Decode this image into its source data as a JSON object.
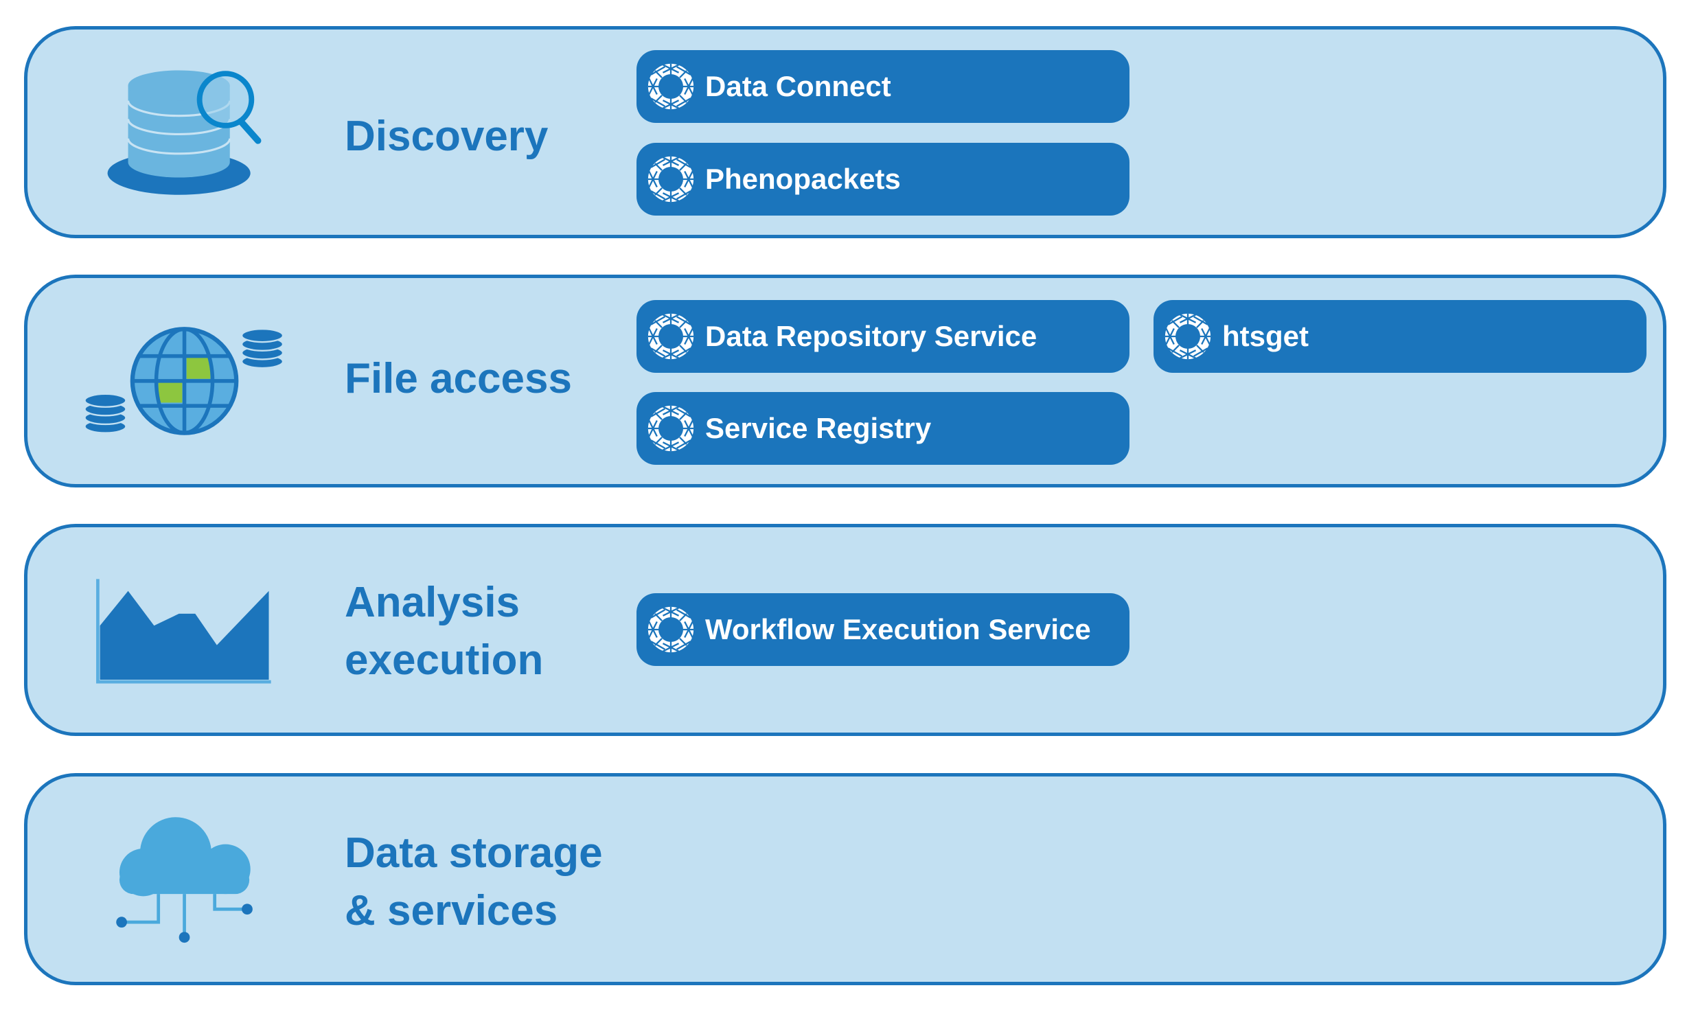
{
  "colors": {
    "band_fill": "#c2e0f2",
    "band_border": "#1c75bc",
    "pill": "#1b75bc",
    "heading": "#1c75bc"
  },
  "rows": [
    {
      "heading": "Discovery",
      "icon": "database-search-icon",
      "pills": [
        "Data Connect",
        "Phenopackets"
      ]
    },
    {
      "heading": "File access",
      "icon": "globe-databases-icon",
      "pills": [
        "Data Repository Service",
        "htsget",
        "Service Registry"
      ]
    },
    {
      "heading": "Analysis\nexecution",
      "icon": "area-chart-icon",
      "pills": [
        "Workflow Execution Service"
      ]
    },
    {
      "heading": "Data storage\n& services",
      "icon": "cloud-network-icon",
      "pills": []
    }
  ],
  "pill_icon": "ga4gh-logo-icon"
}
